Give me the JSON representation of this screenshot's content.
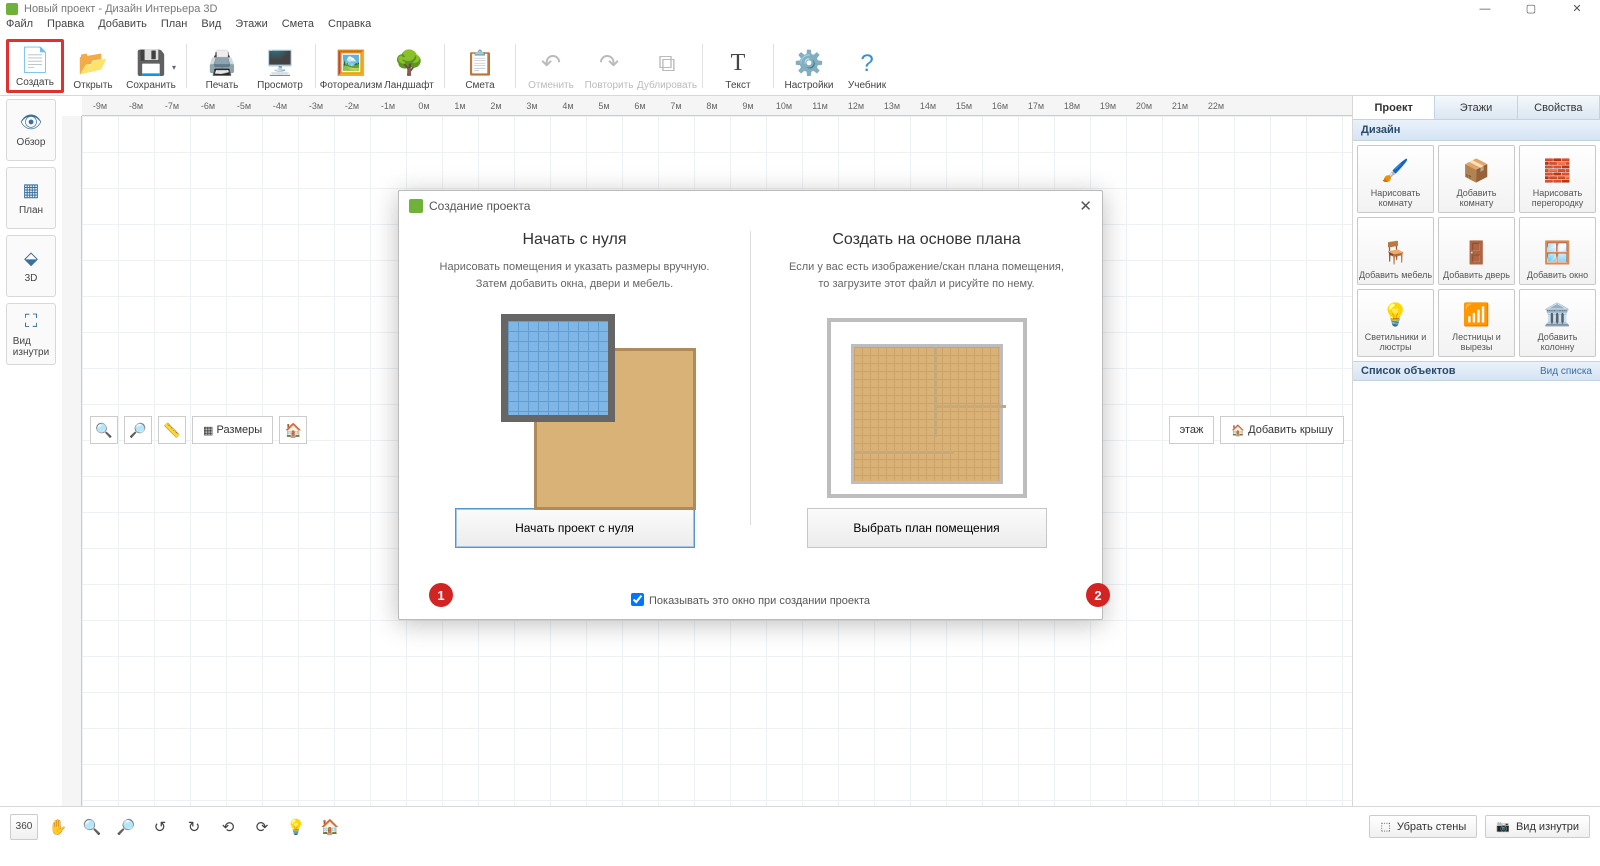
{
  "window": {
    "title": "Новый проект - Дизайн Интерьера 3D",
    "min": "—",
    "max": "▢",
    "close": "✕"
  },
  "menu": [
    "Файл",
    "Правка",
    "Добавить",
    "План",
    "Вид",
    "Этажи",
    "Смета",
    "Справка"
  ],
  "toolbar": {
    "create": "Создать",
    "open": "Открыть",
    "save": "Сохранить",
    "print": "Печать",
    "preview": "Просмотр",
    "photoreal": "Фотореализм",
    "landscape": "Ландшафт",
    "estimate": "Смета",
    "undo": "Отменить",
    "redo": "Повторить",
    "duplicate": "Дублировать",
    "text": "Текст",
    "settings": "Настройки",
    "tutorial": "Учебник"
  },
  "left_views": {
    "overview": "Обзор",
    "plan": "План",
    "three_d": "3D",
    "inside": "Вид\nизнутри"
  },
  "ruler_marks": [
    "-9м",
    "-8м",
    "-7м",
    "-6м",
    "-5м",
    "-4м",
    "-3м",
    "-2м",
    "-1м",
    "0м",
    "1м",
    "2м",
    "3м",
    "4м",
    "5м",
    "6м",
    "7м",
    "8м",
    "9м",
    "10м",
    "11м",
    "12м",
    "13м",
    "14м",
    "15м",
    "16м",
    "17м",
    "18м",
    "19м",
    "20м",
    "21м",
    "22м"
  ],
  "canvas_buttons": {
    "dimensions": "Размеры",
    "add_floor": "этаж",
    "add_roof": "Добавить крышу"
  },
  "right_panel": {
    "tabs": {
      "project": "Проект",
      "floors": "Этажи",
      "properties": "Свойства"
    },
    "design_title": "Дизайн",
    "cards": {
      "draw_room": "Нарисовать комнату",
      "add_room": "Добавить комнату",
      "draw_partition": "Нарисовать перегородку",
      "add_furniture": "Добавить мебель",
      "add_door": "Добавить дверь",
      "add_window": "Добавить окно",
      "lights": "Светильники и люстры",
      "stairs": "Лестницы и вырезы",
      "add_column": "Добавить колонну"
    },
    "objects_title": "Список объектов",
    "objects_view": "Вид списка"
  },
  "modal": {
    "title": "Создание проекта",
    "left": {
      "heading": "Начать с нуля",
      "text1": "Нарисовать помещения и указать размеры вручную.",
      "text2": "Затем добавить окна, двери и мебель.",
      "button": "Начать проект с нуля"
    },
    "right": {
      "heading": "Создать на основе плана",
      "text1": "Если у вас есть изображение/скан плана помещения,",
      "text2": "то загрузите этот файл и рисуйте по нему.",
      "button": "Выбрать план помещения"
    },
    "footer_checkbox": "Показывать это окно при создании проекта",
    "badge1": "1",
    "badge2": "2"
  },
  "bottom": {
    "hide_walls": "Убрать стены",
    "inside_view": "Вид изнутри"
  }
}
